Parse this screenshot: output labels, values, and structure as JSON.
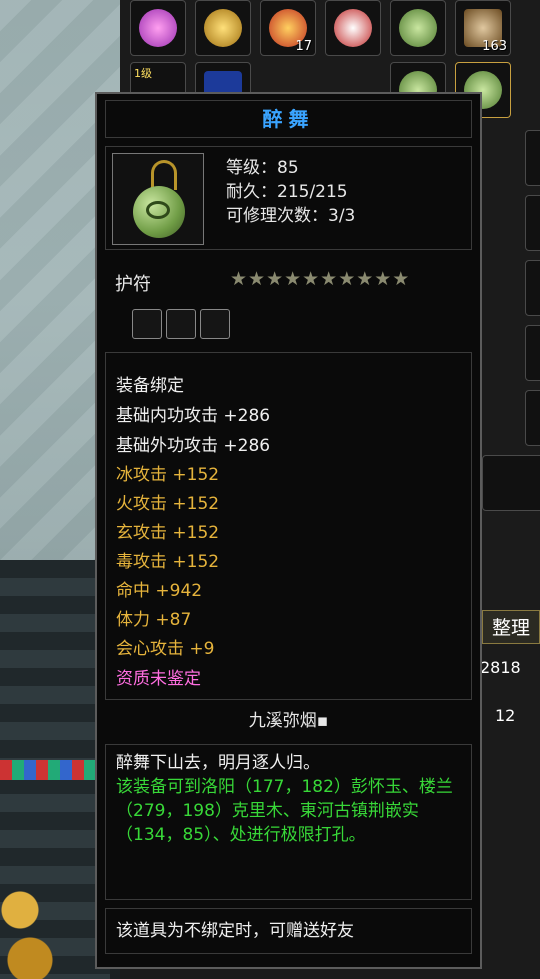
{
  "item": {
    "name": "醉舞",
    "level": "等级：85",
    "durability": "耐久：215/215",
    "repair": "可修理次数：3/3",
    "category": "护符",
    "stars": "★★★★★★★★★★",
    "bind": "装备绑定",
    "attributes_white": [
      "基础内功攻击 +286",
      "基础外功攻击 +286"
    ],
    "attributes_gold": [
      "冰攻击 +152",
      "火攻击 +152",
      "玄攻击 +152",
      "毒攻击 +152",
      "命中 +942",
      "体力 +87",
      "会心攻击 +9"
    ],
    "quality": "资质未鉴定",
    "set_name": "九溪弥烟▪",
    "flavor": "醉舞下山去，明月逐人归。",
    "socket_hint": "该装备可到洛阳（177，182）彭怀玉、楼兰（279，198）克里木、東河古镇荆嵌实（134，85）、处进行极限打孔。",
    "footer": "该道具为不绑定时，可赠送好友"
  },
  "inventory": {
    "counts": [
      "17",
      "163"
    ],
    "level_badge": "1级",
    "sort_button": "整理",
    "value1": "2818",
    "value2": "12"
  },
  "colors": {
    "title": "#3aa4ff",
    "gold_attr": "#e6b43c",
    "quality": "#ff6ee0",
    "hint": "#38d838"
  }
}
